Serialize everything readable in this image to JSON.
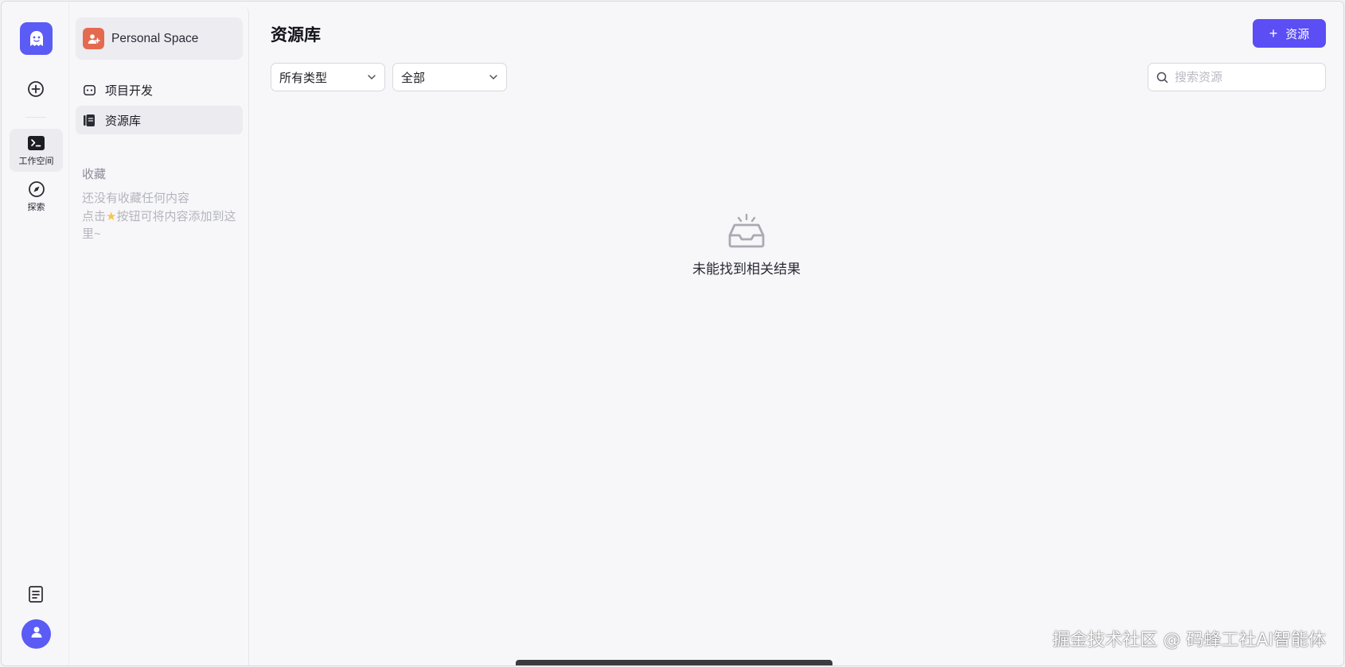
{
  "rail": {
    "logo_icon": "ghost-logo-icon",
    "create_icon": "plus-circle-icon",
    "items": [
      {
        "label": "工作空间",
        "icon": "terminal-icon",
        "active": true
      },
      {
        "label": "探索",
        "icon": "compass-icon",
        "active": false
      }
    ],
    "doc_icon": "document-icon",
    "avatar_icon": "user-icon"
  },
  "sidebar": {
    "space_name": "Personal Space",
    "nav": [
      {
        "label": "项目开发",
        "icon": "bot-icon",
        "active": false
      },
      {
        "label": "资源库",
        "icon": "library-icon",
        "active": true
      }
    ],
    "favorites_title": "收藏",
    "favorites_empty_line1": "还没有收藏任何内容",
    "favorites_empty_line2_a": "点击",
    "favorites_empty_line2_b": "按钮可将内容添加到这里~"
  },
  "main": {
    "title": "资源库",
    "add_button_label": "资源",
    "filter_type": "所有类型",
    "filter_scope": "全部",
    "search_placeholder": "搜索资源",
    "empty_text": "未能找到相关结果"
  },
  "watermark": "掘金技术社区 @ 码蜂工社AI智能体",
  "colors": {
    "accent": "#5b4ef5",
    "space_avatar": "#e46a4f",
    "background": "#f7f7fa"
  }
}
